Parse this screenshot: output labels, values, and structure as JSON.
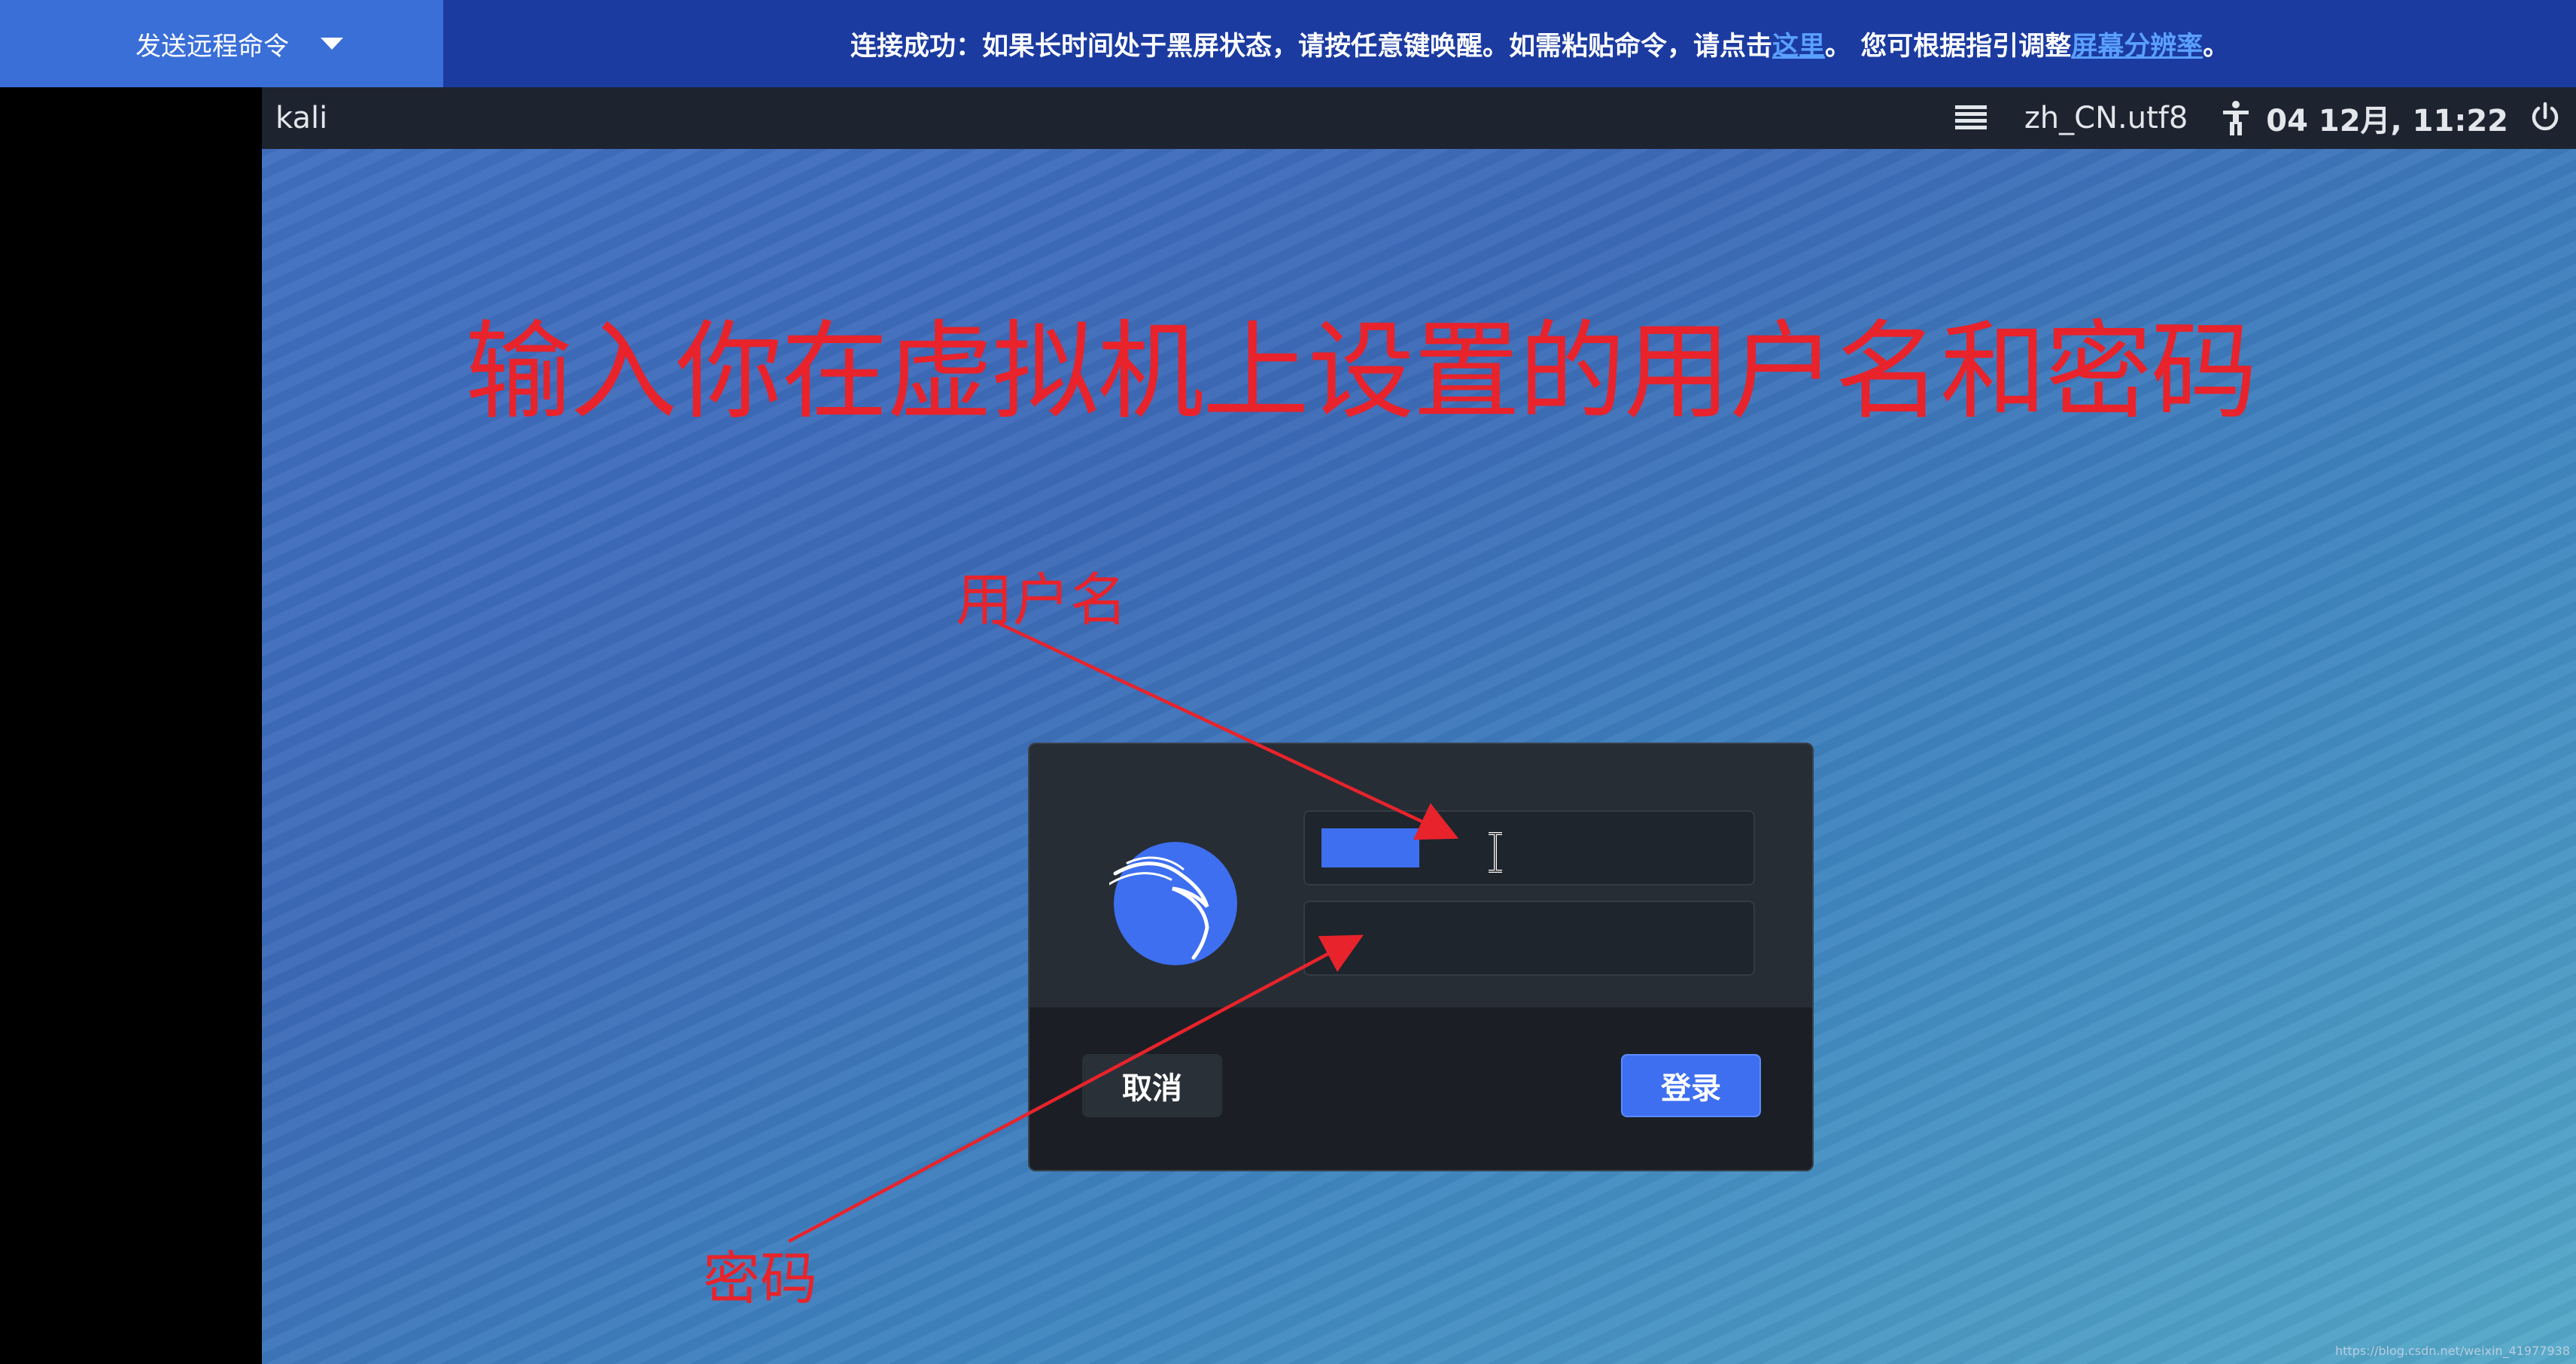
{
  "remote_bar": {
    "send_command_label": "发送远程命令",
    "notice_prefix": "连接成功：如果长时间处于黑屏状态，请按任意键唤醒。如需粘贴命令，请点击",
    "notice_link1": "这里",
    "notice_middle": "。 您可根据指引调整",
    "notice_link2": "屏幕分辨率",
    "notice_suffix": "。"
  },
  "vm_panel": {
    "hostname": "kali",
    "locale": "zh_CN.utf8",
    "datetime": "04 12月, 11:22",
    "icons": [
      "menu-icon",
      "accessibility-icon",
      "power-icon"
    ]
  },
  "annotations": {
    "title": "输入你在虚拟机上设置的用户名和密码",
    "username_label": "用户名",
    "password_label": "密码",
    "color": "#e8232b"
  },
  "login": {
    "username_value": "",
    "password_value": "",
    "cancel_label": "取消",
    "login_label": "登录",
    "accent": "#3d6ff0"
  },
  "watermark": "https://blog.csdn.net/weixin_41977938"
}
